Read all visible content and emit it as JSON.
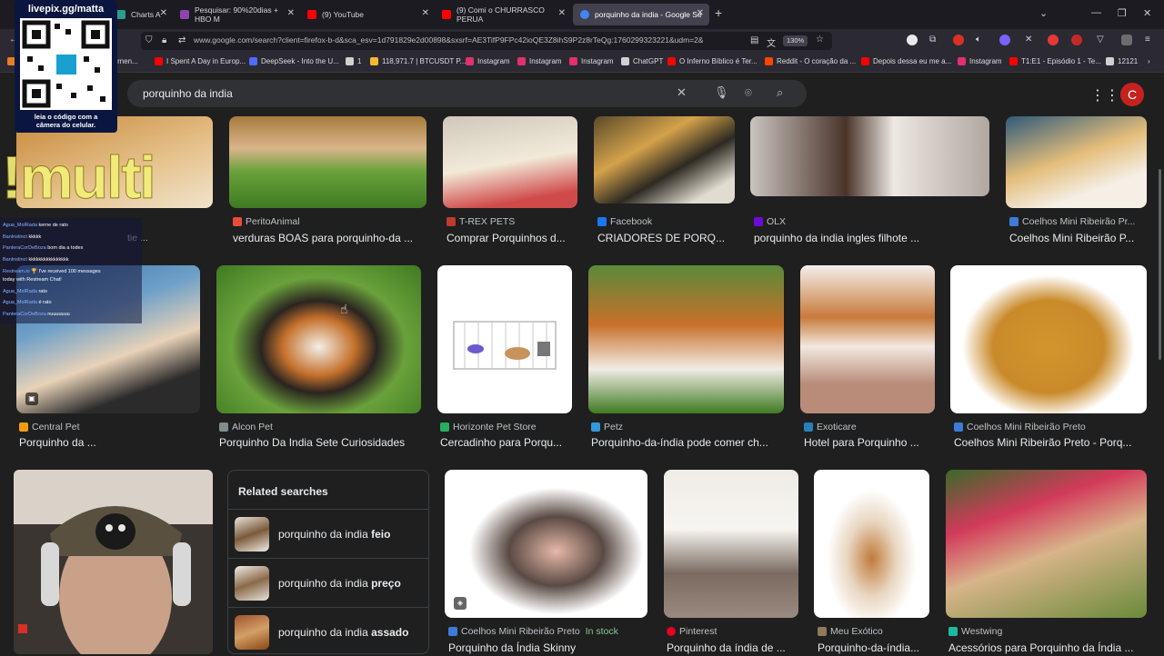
{
  "browser": {
    "tabs": [
      {
        "label": "Charts A",
        "fav": "#2a9d8f"
      },
      {
        "label": "Pesquisar: 90%20dias + HBO M",
        "fav": "#8e44ad"
      },
      {
        "label": "(9) YouTube",
        "fav": "#ff0000"
      },
      {
        "label": "(9) Comi o CHURRASCO PERUA",
        "fav": "#ff0000"
      },
      {
        "label": "porquinho da india - Google Se",
        "fav": "#4285f4"
      }
    ],
    "url": "www.google.com/search?client=firefox-b-d&sca_esv=1d791829e2d00898&sxsrf=AE3TifP9FPc42ioQE3Z8ihS9P2z8rTeQg:1760299323221&udm=2&",
    "zoom": "130%",
    "bookmarks": [
      {
        "label": "rarnen...",
        "fav": "#e67e22"
      },
      {
        "label": "I Spent A Day in Europ...",
        "fav": "#ff0000"
      },
      {
        "label": "DeepSeek - Into the U...",
        "fav": "#4d6bfe"
      },
      {
        "label": "1",
        "fav": "#d0d0d0"
      },
      {
        "label": "118,971.7 | BTCUSDT P...",
        "fav": "#f3ba2f"
      },
      {
        "label": "Instagram",
        "fav": "#e1306c"
      },
      {
        "label": "Instagram",
        "fav": "#e1306c"
      },
      {
        "label": "Instagram",
        "fav": "#e1306c"
      },
      {
        "label": "ChatGPT",
        "fav": "#d0d0d0"
      },
      {
        "label": "O Inferno Bíblico é Ter...",
        "fav": "#ff0000"
      },
      {
        "label": "Reddit - O coração da ...",
        "fav": "#ff4500"
      },
      {
        "label": "Depois dessa eu me a...",
        "fav": "#ff0000"
      },
      {
        "label": "Instagram",
        "fav": "#e1306c"
      },
      {
        "label": "T1:E1 - Episódio 1 - Te...",
        "fav": "#ff0000"
      },
      {
        "label": "12121",
        "fav": "#d0d0d0"
      }
    ]
  },
  "google": {
    "query": "porquinho da india",
    "profile_initial": "C"
  },
  "results": {
    "row1": [
      {
        "source": "tie ...",
        "title": "",
        "fav": "#888"
      },
      {
        "source": "PeritoAnimal",
        "title": "verduras BOAS para porquinho-da ...",
        "fav": "#e74c3c"
      },
      {
        "source": "T-REX PETS",
        "title": "Comprar Porquinhos d...",
        "fav": "#c0392b"
      },
      {
        "source": "Facebook",
        "title": "CRIADORES DE PORQ...",
        "fav": "#1877f2"
      },
      {
        "source": "OLX",
        "title": "porquinho da india ingles filhote ...",
        "fav": "#6e0ad6"
      },
      {
        "source": "Coelhos Mini Ribeirão Pr...",
        "title": "Coelhos Mini Ribeirão P...",
        "fav": "#3d7bd8"
      }
    ],
    "row2": [
      {
        "source": "Central Pet",
        "title": "Porquinho da ...",
        "fav": "#f39c12"
      },
      {
        "source": "Alcon Pet",
        "title": "Porquinho Da India Sete Curiosidades",
        "fav": "#7f8c8d"
      },
      {
        "source": "Horizonte Pet Store",
        "title": "Cercadinho para Porqu...",
        "fav": "#27ae60"
      },
      {
        "source": "Petz",
        "title": "Porquinho-da-índia pode comer ch...",
        "fav": "#3498db"
      },
      {
        "source": "Exoticare",
        "title": "Hotel para Porquinho ...",
        "fav": "#2980b9"
      },
      {
        "source": "Coelhos Mini Ribeirão Preto",
        "title": "Coelhos Mini Ribeirão Preto - Porq...",
        "fav": "#3d7bd8"
      }
    ],
    "row3": [
      {
        "source": "Coelhos Mini Ribeirão Preto",
        "stock": "In stock",
        "title": "Porquinho da Índia Skinny",
        "fav": "#3d7bd8"
      },
      {
        "source": "Pinterest",
        "title": "Porquinho da índia de ...",
        "fav": "#e60023"
      },
      {
        "source": "Meu Exótico",
        "title": "Porquinho-da-índia...",
        "fav": "#8e7b5a"
      },
      {
        "source": "Westwing",
        "title": "Acessórios para Porquinho da Índia ...",
        "fav": "#1abc9c"
      }
    ]
  },
  "related": {
    "title": "Related searches",
    "items": [
      {
        "prefix": "porquinho da india ",
        "bold": "feio"
      },
      {
        "prefix": "porquinho da india ",
        "bold": "preço"
      },
      {
        "prefix": "porquinho da india ",
        "bold": "assado"
      }
    ]
  },
  "overlay": {
    "site": "livepix.gg/matta",
    "qr_caption_1": "leia o código com a",
    "qr_caption_2": "câmera do celular.",
    "multi": "!multi",
    "chat": [
      {
        "user": "Agua_MolRada",
        "msg": "kerne de rato"
      },
      {
        "user": "Banlnstinct",
        "msg": "kkkkk"
      },
      {
        "user": "PanteraCorDeBoza",
        "msg": "bom dia a todex"
      },
      {
        "user": "Banlnstinct",
        "msg": "kkkkkkkkkkkkkkkk"
      },
      {
        "user": "Restream.io",
        "msg": "🏆 I've received 100 messages"
      },
      {
        "user": "",
        "msg": "today with Restream Chat!"
      },
      {
        "user": "Agua_MolRada",
        "msg": "rato"
      },
      {
        "user": "Agua_MolRada",
        "msg": "é rato"
      },
      {
        "user": "PanteraCorDeBoza",
        "msg": "nuuuuuuu"
      }
    ]
  }
}
